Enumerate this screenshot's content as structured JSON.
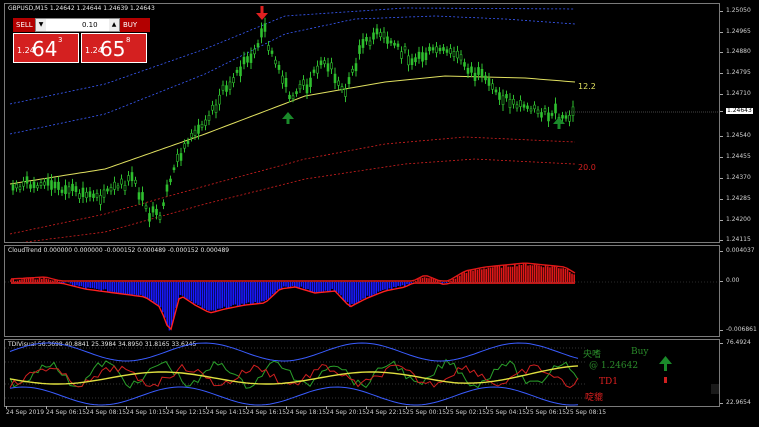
{
  "main": {
    "title": "GBPUSD,M15  1.24642 1.24644 1.24639 1.24643",
    "axis_ticks": [
      "1.25050",
      "1.24965",
      "1.24880",
      "1.24795",
      "1.24710",
      "1.24643",
      "1.24540",
      "1.24455",
      "1.24370",
      "1.24285",
      "1.24200",
      "1.24115"
    ],
    "band_labels": [
      "12.2",
      "20.0"
    ],
    "trade": {
      "sell_label": "SELL",
      "buy_label": "BUY",
      "lot": "0.10",
      "sell_small": "1.24",
      "sell_big": "64",
      "sell_sup": "3",
      "buy_small": "1.24",
      "buy_big": "65",
      "buy_sup": "8"
    },
    "colors": {
      "bull": "#2fbf2f",
      "bear": "#2fbf2f",
      "mid": "#e0e060",
      "upper": "#3a5cff",
      "lower": "#d42020"
    }
  },
  "cloud": {
    "title": "CloudTrend 0.000000 0.000000 -0.000152 0.000489 -0.000152 0.000489",
    "axis_ticks": [
      "0.004037",
      "0.00",
      "-0.006861"
    ]
  },
  "tdi": {
    "title": "TDIVisual 56.3698 40.8841 25.3984 34.8950 31.8165 33.6245",
    "axis_ticks": [
      "76.4924",
      "22.9654"
    ],
    "signal_text": "Buy",
    "price_text": "@ 1.24642",
    "td_label": "TD1"
  },
  "time_labels": [
    "24 Sep 2019",
    "24 Sep 06:15",
    "24 Sep 08:15",
    "24 Sep 10:15",
    "24 Sep 12:15",
    "24 Sep 14:15",
    "24 Sep 16:15",
    "24 Sep 18:15",
    "24 Sep 20:15",
    "24 Sep 22:15",
    "25 Sep 00:15",
    "25 Sep 02:15",
    "25 Sep 04:15",
    "25 Sep 06:15",
    "25 Sep 08:15"
  ]
}
